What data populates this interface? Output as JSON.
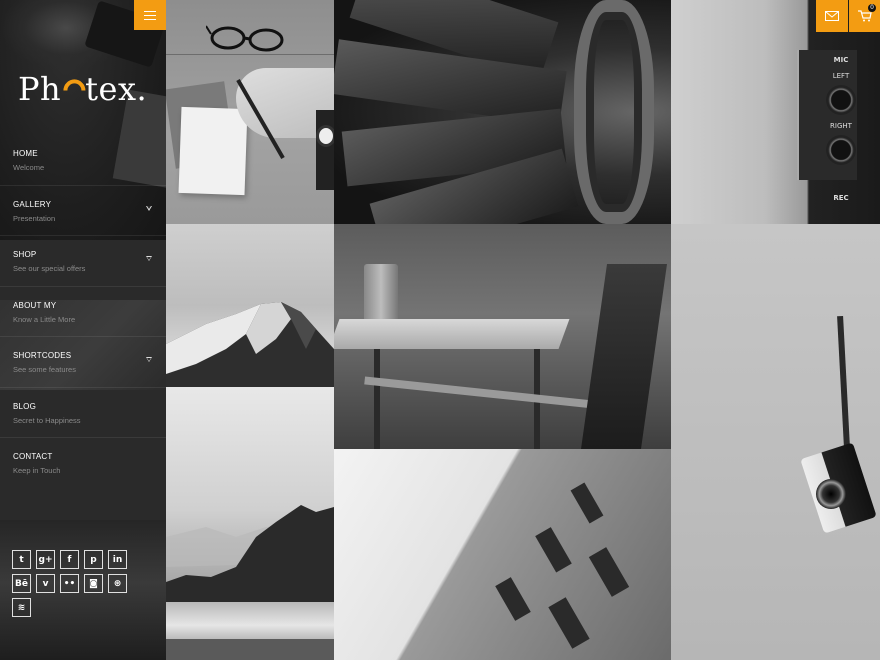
{
  "brand": {
    "logo_prefix": "Ph",
    "logo_suffix": "tex",
    "logo_dot": "."
  },
  "accent_color": "#f39c12",
  "menu_toggle": {
    "icon": "hamburger-icon"
  },
  "nav": [
    {
      "title": "HOME",
      "subtitle": "Welcome",
      "has_submenu": false
    },
    {
      "title": "GALLERY",
      "subtitle": "Presentation",
      "has_submenu": true
    },
    {
      "title": "SHOP",
      "subtitle": "See our special offers",
      "has_submenu": true
    },
    {
      "title": "ABOUT MY",
      "subtitle": "Know a Little More",
      "has_submenu": false
    },
    {
      "title": "SHORTCODES",
      "subtitle": "See some features",
      "has_submenu": true
    },
    {
      "title": "BLOG",
      "subtitle": "Secret to Happiness",
      "has_submenu": false
    },
    {
      "title": "CONTACT",
      "subtitle": "Keep in Touch",
      "has_submenu": false
    }
  ],
  "socials": [
    {
      "name": "twitter",
      "glyph": "t"
    },
    {
      "name": "google-plus",
      "glyph": "g+"
    },
    {
      "name": "facebook",
      "glyph": "f"
    },
    {
      "name": "pinterest",
      "glyph": "p"
    },
    {
      "name": "linkedin",
      "glyph": "in"
    },
    {
      "name": "behance",
      "glyph": "Bē"
    },
    {
      "name": "vimeo",
      "glyph": "v"
    },
    {
      "name": "flickr",
      "glyph": "••"
    },
    {
      "name": "instagram",
      "glyph": "◙"
    },
    {
      "name": "dribbble",
      "glyph": "⊛"
    },
    {
      "name": "rss",
      "glyph": "≋"
    }
  ],
  "header_actions": {
    "mail_icon": "mail-icon",
    "cart_icon": "cart-icon",
    "cart_count": "0"
  },
  "radio_labels": {
    "mic": "MIC",
    "left": "LEFT",
    "right": "RIGHT",
    "rec": "REC"
  }
}
